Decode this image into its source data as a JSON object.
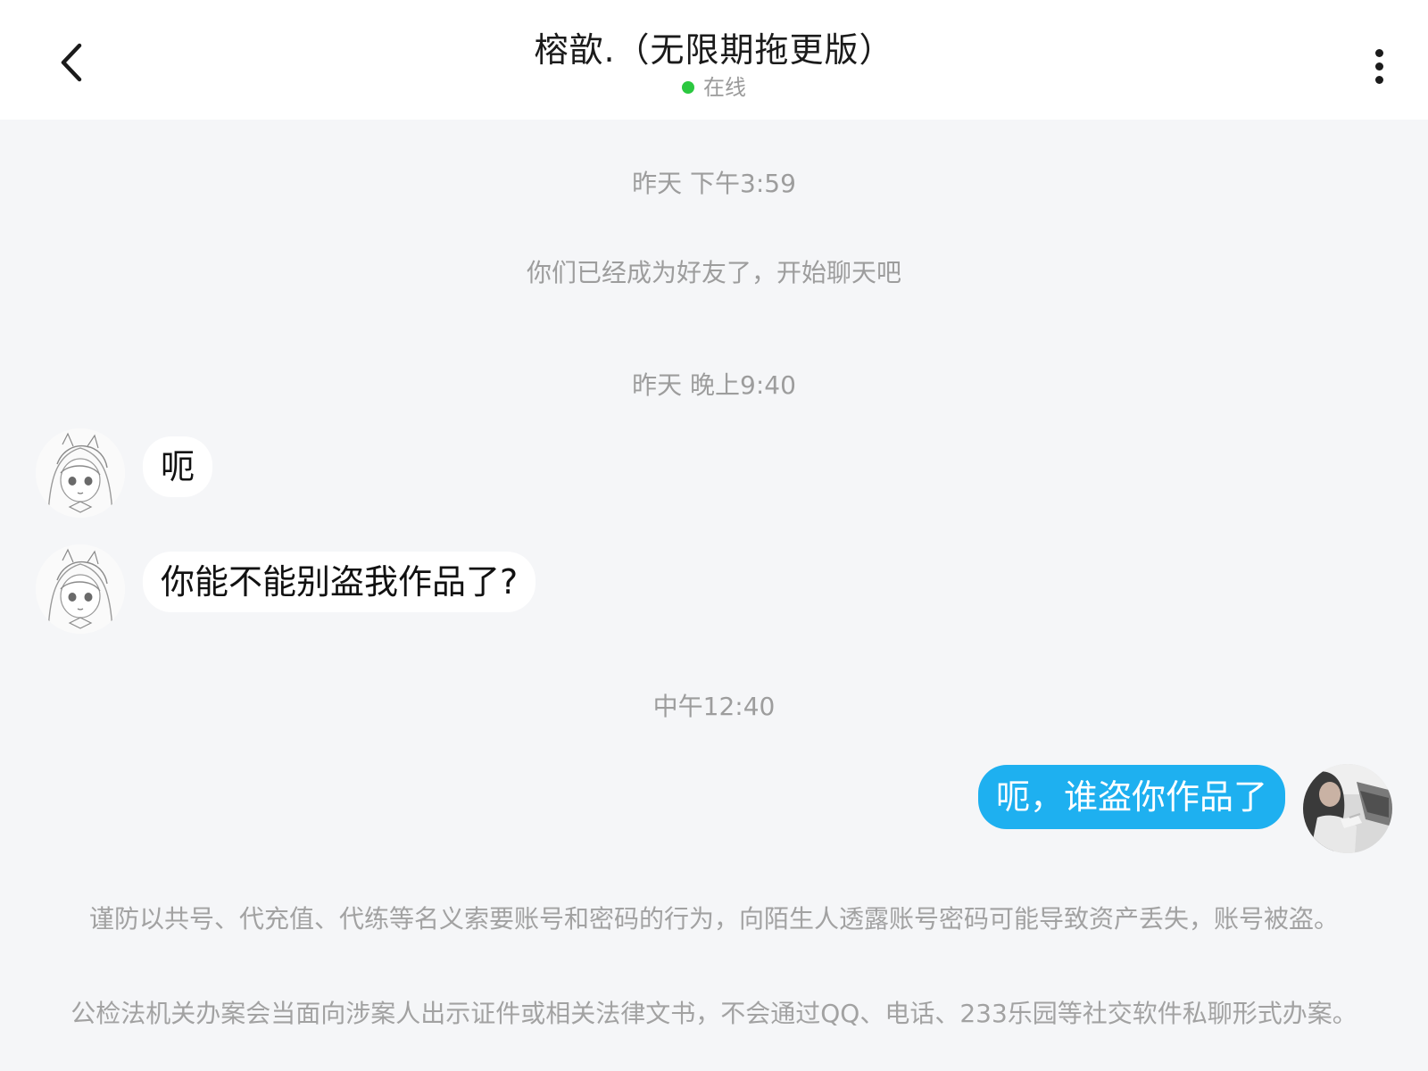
{
  "header": {
    "back_icon": "chevron-left-icon",
    "title": "榕歆.（无限期拖更版）",
    "status_text": "在线",
    "status_color": "#2bc840",
    "more_icon": "more-vertical-icon"
  },
  "timestamps": {
    "t1": "昨天 下午3:59",
    "t2": "昨天 晚上9:40",
    "t3": "中午12:40"
  },
  "system_messages": {
    "friend_added": "你们已经成为好友了，开始聊天吧"
  },
  "messages": [
    {
      "side": "left",
      "text": "呃"
    },
    {
      "side": "left",
      "text": "你能不能别盗我作品了?"
    },
    {
      "side": "right",
      "text": "呃，谁盗你作品了"
    }
  ],
  "colors": {
    "outgoing_bubble": "#1eb0f0",
    "incoming_bubble": "#ffffff",
    "background": "#f5f6f8"
  },
  "notices": [
    "谨防以共号、代充值、代练等名义索要账号和密码的行为，向陌生人透露账号密码可能导致资产丢失，账号被盗。",
    "公检法机关办案会当面向涉案人出示证件或相关法律文书，不会通过QQ、电话、233乐园等社交软件私聊形式办案。"
  ]
}
